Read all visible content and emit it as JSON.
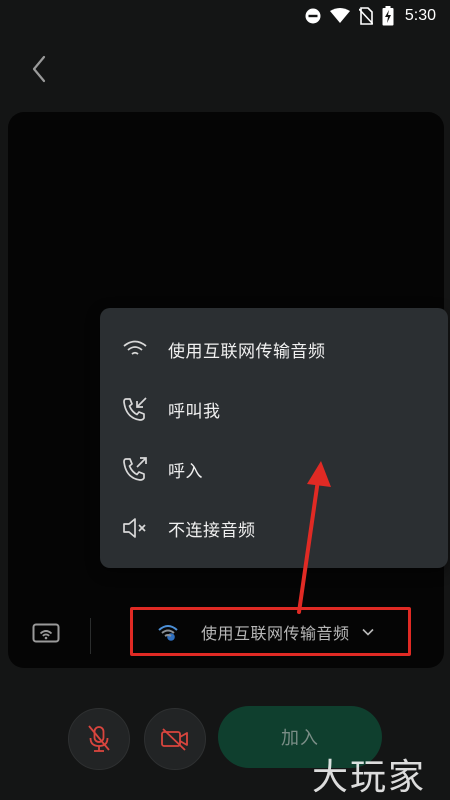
{
  "status_bar": {
    "time": "5:30",
    "icons": [
      "dnd-icon",
      "wifi-signal-icon",
      "no-sim-icon",
      "battery-charging-icon"
    ]
  },
  "header": {
    "back_icon": "chevron-left-icon"
  },
  "audio_menu": {
    "items": [
      {
        "label": "使用互联网传输音频",
        "icon": "wifi-icon"
      },
      {
        "label": "呼叫我",
        "icon": "phone-incoming-icon"
      },
      {
        "label": "呼入",
        "icon": "phone-outgoing-icon"
      },
      {
        "label": "不连接音频",
        "icon": "speaker-mute-icon"
      }
    ]
  },
  "audio_selector": {
    "label": "使用互联网传输音频",
    "icon": "wifi-audio-icon",
    "chevron_icon": "chevron-down-icon"
  },
  "controls": {
    "join_label": "加入",
    "mic_icon": "mic-off-icon",
    "camera_icon": "camera-off-icon",
    "cast_icon": "screen-cast-icon"
  },
  "watermark": "大玩家",
  "colors": {
    "background": "#141515",
    "menu_bg": "#2b2f32",
    "highlight_red": "#e02a24",
    "join_bg": "#0f3f2e",
    "mute_icon_red": "#d9453e"
  }
}
